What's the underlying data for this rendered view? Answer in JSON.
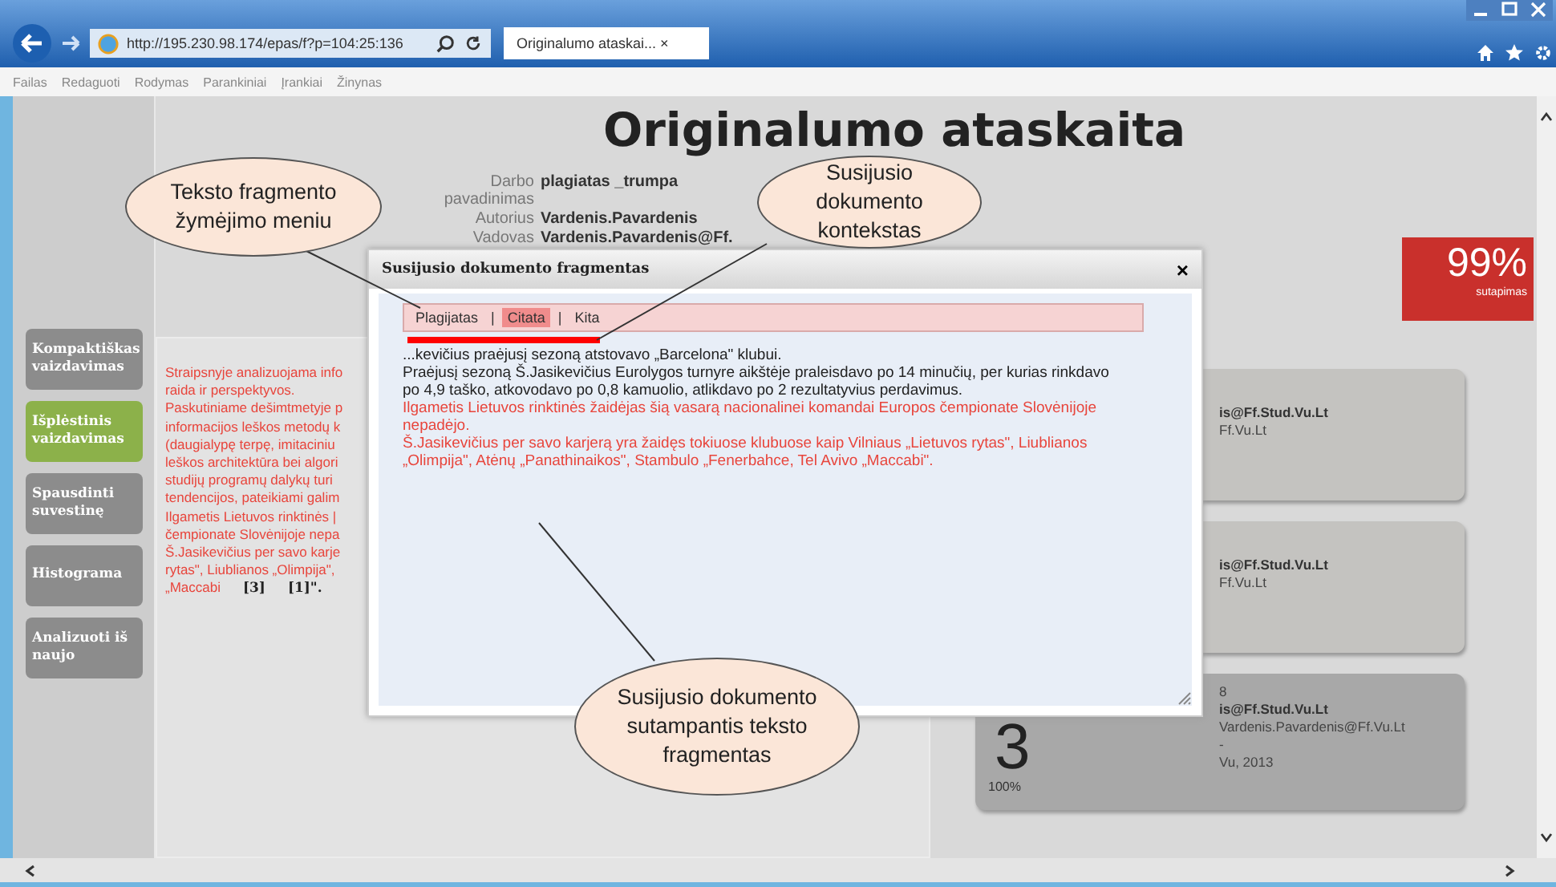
{
  "browser": {
    "address": "http://195.230.98.174/epas/f?p=104:25:136",
    "tab": "Originalumo ataskai... ×",
    "menu": [
      "Failas",
      "Redaguoti",
      "Rodymas",
      "Parankiniai",
      "Įrankiai",
      "Žinynas"
    ]
  },
  "sidebar": {
    "items": [
      {
        "label": "Kompaktiškas vaizdavimas",
        "selected": false
      },
      {
        "label": "Išplėstinis vaizdavimas",
        "selected": true
      },
      {
        "label": "Spausdinti suvestinę",
        "selected": false
      },
      {
        "label": "Histograma",
        "selected": false
      },
      {
        "label": "Analizuoti iš naujo",
        "selected": false
      }
    ]
  },
  "report": {
    "title": "Originalumo ataskaita",
    "fields": [
      {
        "label": "Darbo pavadinimas",
        "value": "plagiatas _trumpa"
      },
      {
        "label": "Autorius",
        "value": "Vardenis.Pavardenis"
      },
      {
        "label": "Vadovas",
        "value": "Vardenis.Pavardenis@Ff."
      }
    ],
    "score": {
      "value": "99%",
      "label": "sutapimas"
    },
    "source_lines": [
      "Straipsnyje analizuojama info",
      "raida ir perspektyvos.",
      "Paskutiniame dešimtmetyje p",
      "informacijos leškos metodų k",
      "(daugialypę terpę, imitaciniu",
      "leškos architektūra bei algori",
      "studijų programų dalykų turi",
      "tendencijos, pateikiami galim",
      "Ilgametis Lietuvos rinktinės |",
      "čempionate Slovėnijoje nepa",
      "Š.Jasikevičius per savo karje",
      "rytas\", Liublianos „Olimpija\",",
      "„Maccabi"
    ],
    "citations": [
      "[3]",
      "[1]\"."
    ],
    "cards": [
      {
        "lines": [
          {
            "text": "is@Ff.Stud.Vu.Lt",
            "kind": "bold"
          },
          {
            "text": "Ff.Vu.Lt",
            "kind": "plain"
          }
        ]
      },
      {
        "lines": [
          {
            "text": "is@Ff.Stud.Vu.Lt",
            "kind": "bold"
          },
          {
            "text": "Ff.Vu.Lt",
            "kind": "plain"
          }
        ]
      },
      {
        "number": "3",
        "percent": "100%",
        "lines": [
          {
            "text": "8",
            "kind": "plain"
          },
          {
            "text": "is@Ff.Stud.Vu.Lt",
            "kind": "bold"
          },
          {
            "text": "Vardenis.Pavardenis@Ff.Vu.Lt",
            "kind": "plain"
          },
          {
            "text": "-",
            "kind": "plain"
          },
          {
            "text": "Vu, 2013",
            "kind": "plain"
          }
        ]
      }
    ]
  },
  "dialog": {
    "title": "Susijusio dokumento fragmentas",
    "close": "×",
    "separator": "|",
    "menu": [
      {
        "label": "Plagijatas",
        "selected": false
      },
      {
        "label": "Citata",
        "selected": true
      },
      {
        "label": "Kita",
        "selected": false
      }
    ],
    "paragraphs": [
      {
        "text": "...kevičius praėjusį sezoną atstovavo „Barcelona\" klubui.",
        "kind": "context"
      },
      {
        "text": "Praėjusį sezoną Š.Jasikevičius Eurolygos turnyre aikštėje praleisdavo po 14 minučių, per kurias rinkdavo po 4,9 taško, atkovodavo po 0,8 kamuolio, atlikdavo po 2 rezultatyvius perdavimus.",
        "kind": "context"
      },
      {
        "text": "Ilgametis Lietuvos rinktinės žaidėjas šią vasarą nacionalinei komandai Europos čempionate Slovėnijoje nepadėjo.",
        "kind": "match"
      },
      {
        "text": "Š.Jasikevičius per savo karjerą yra žaidęs tokiuose klubuose kaip Vilniaus „Lietuvos rytas\", Liublianos „Olimpija\", Atėnų „Panathinaikos\", Stambulo „Fenerbahce, Tel Avivo „Maccabi\".",
        "kind": "match"
      }
    ]
  },
  "callouts": [
    {
      "text": "Teksto fragmento žymėjimo meniu"
    },
    {
      "text": "Susijusio dokumento kontekstas"
    },
    {
      "text": "Susijusio dokumento sutampantis teksto fragmentas"
    }
  ]
}
